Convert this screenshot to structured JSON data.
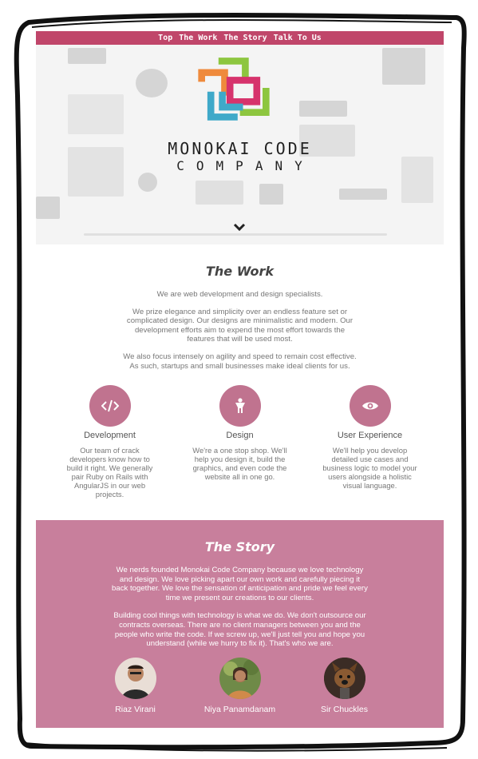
{
  "nav": {
    "items": [
      {
        "label": "Top"
      },
      {
        "label": "The Work"
      },
      {
        "label": "The Story"
      },
      {
        "label": "Talk To Us"
      }
    ]
  },
  "hero": {
    "logo_line1": "MONOKAI CODE",
    "logo_line2": "COMPANY",
    "scroll_icon": "chevron-down-icon"
  },
  "work": {
    "title": "The Work",
    "paragraphs": [
      "We are web development and design specialists.",
      "We prize elegance and simplicity over an endless feature set or complicated design. Our designs are minimalistic and modern. Our development efforts aim to expend the most effort towards the features that will be used most.",
      "We also focus intensely on agility and speed to remain cost effective. As such, startups and small businesses make ideal clients for us."
    ],
    "services": [
      {
        "icon": "code-icon",
        "title": "Development",
        "text": "Our team of crack developers know how to build it right. We generally pair Ruby on Rails with AngularJS in our web projects."
      },
      {
        "icon": "person-icon",
        "title": "Design",
        "text": "We're a one stop shop. We'll help you design it, build the graphics, and even code the website all in one go."
      },
      {
        "icon": "eye-icon",
        "title": "User Experience",
        "text": "We'll help you develop detailed use cases and business logic to model your users alongside a holistic visual language."
      }
    ]
  },
  "story": {
    "title": "The Story",
    "paragraphs": [
      "We nerds founded Monokai Code Company because we love technology and design. We love picking apart our own work and carefully piecing it back together. We love the sensation of anticipation and pride we feel every time we present our creations to our clients.",
      "Building cool things with technology is what we do. We don't outsource our contracts overseas. There are no client managers between you and the people who write the code. If we screw up, we'll just tell you and hope you understand (while we hurry to fix it). That's who we are."
    ],
    "people": [
      {
        "name": "Riaz Virani"
      },
      {
        "name": "Niya Panamdanam"
      },
      {
        "name": "Sir Chuckles"
      }
    ]
  },
  "colors": {
    "nav_bg": "#c0466a",
    "accent": "#c0738f",
    "story_bg": "#c87f9c",
    "logo_orange": "#ef8a3c",
    "logo_green": "#8dc63f",
    "logo_teal": "#3fa9c9",
    "logo_pink": "#d6336c"
  }
}
